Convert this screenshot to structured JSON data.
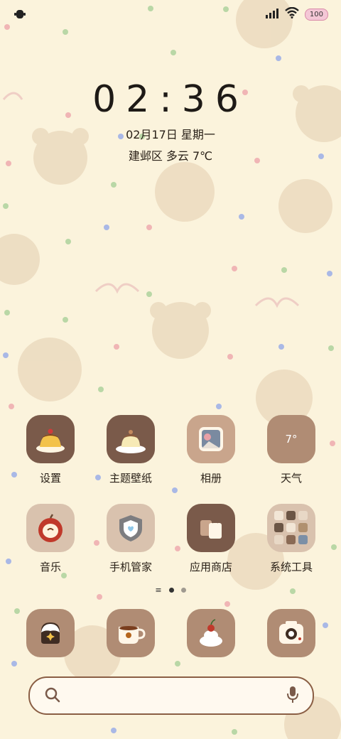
{
  "status_bar": {
    "battery": "100"
  },
  "clock": {
    "time": "02:36",
    "date": "02月17日 星期一",
    "weather": "建邺区 多云 7℃"
  },
  "apps_row1": [
    {
      "label": "设置",
      "icon": "pudding-icon"
    },
    {
      "label": "主题壁纸",
      "icon": "cake-plate-icon"
    },
    {
      "label": "相册",
      "icon": "photo-icon"
    },
    {
      "label": "天气",
      "icon": "weather-icon",
      "badge": "7°"
    }
  ],
  "apps_row2": [
    {
      "label": "音乐",
      "icon": "apple-icon"
    },
    {
      "label": "手机管家",
      "icon": "shield-icon"
    },
    {
      "label": "应用商店",
      "icon": "bag-icon"
    },
    {
      "label": "系统工具",
      "icon": "folder-icon"
    }
  ],
  "dock": [
    {
      "icon": "phone-app-icon"
    },
    {
      "icon": "coffee-cup-icon"
    },
    {
      "icon": "cherry-cupcake-icon"
    },
    {
      "icon": "camera-icon"
    }
  ],
  "colors": {
    "background": "#fbf3dc",
    "tile_dark": "#7a5a4a",
    "tile_light": "#d9c2ae",
    "tile_tan": "#b08c74",
    "search_border": "#8a5e44"
  }
}
